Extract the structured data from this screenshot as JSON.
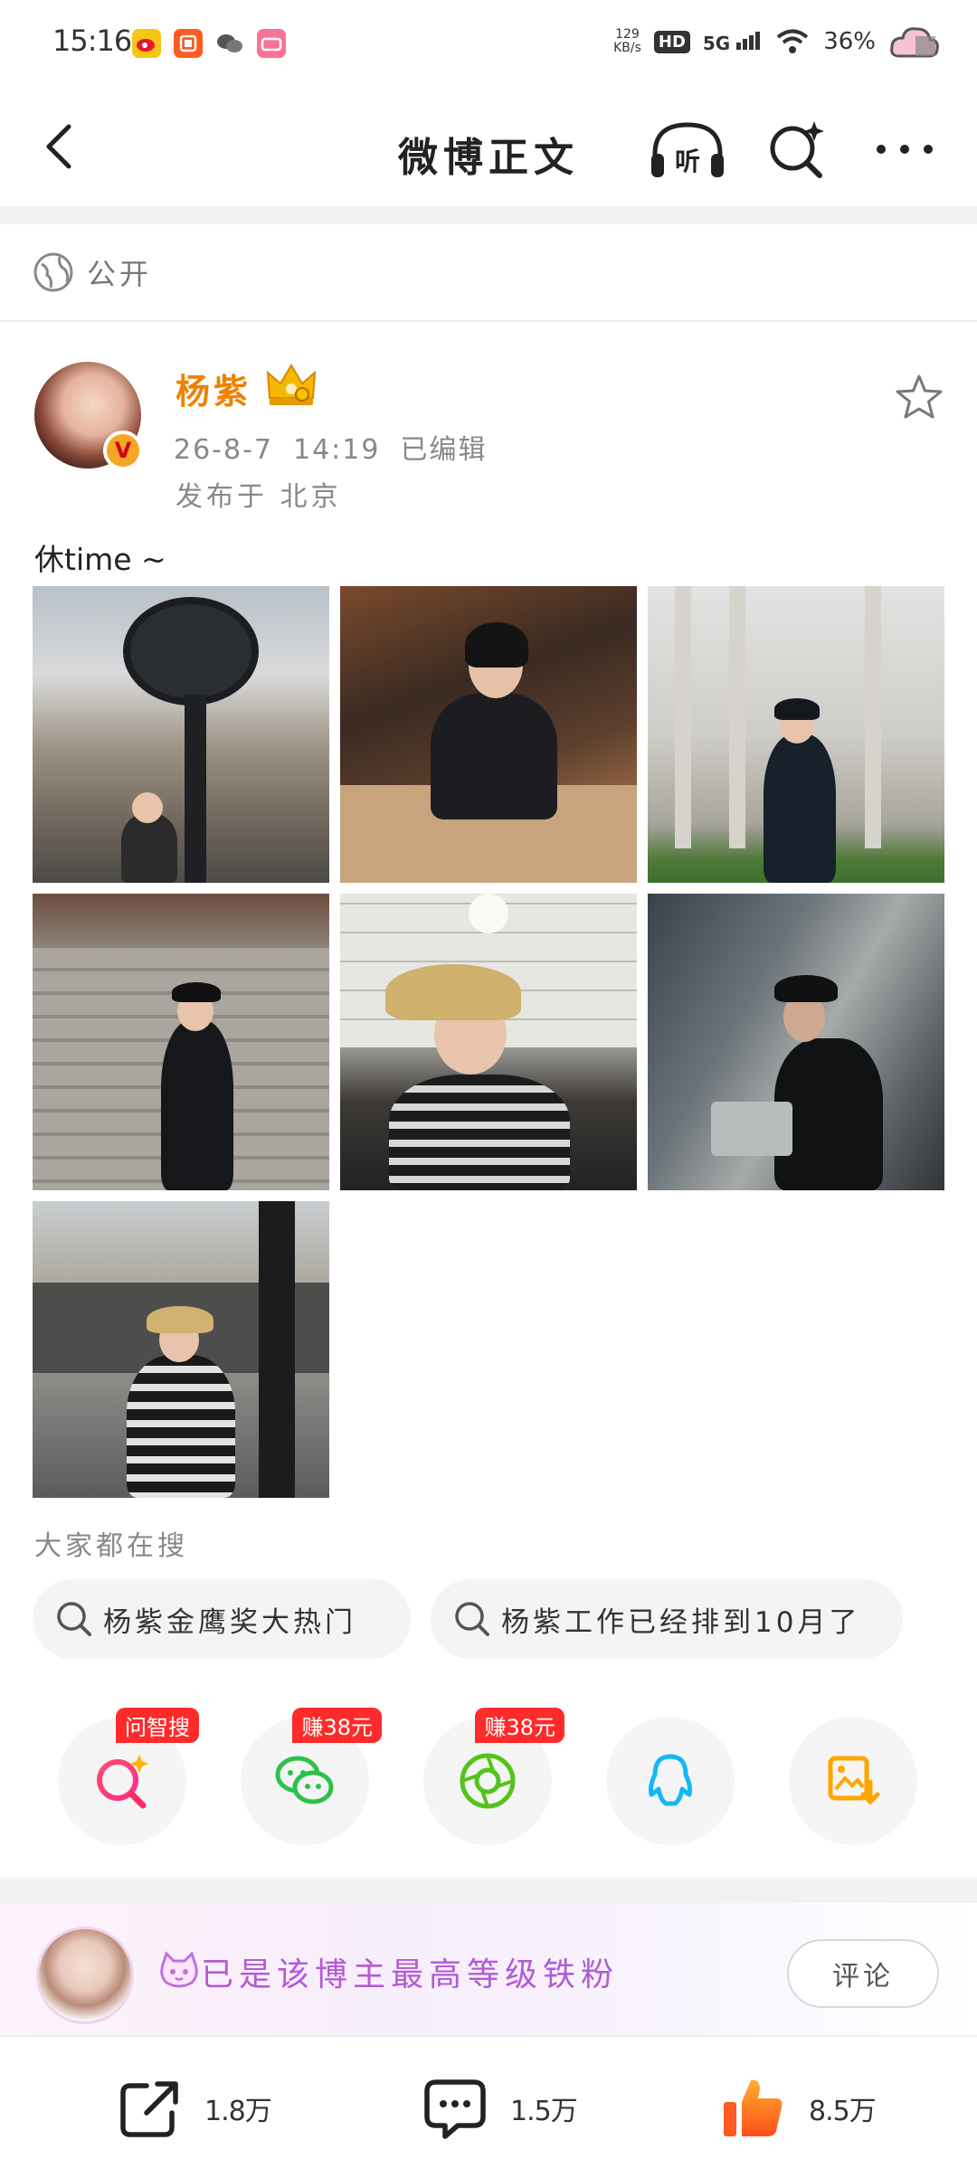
{
  "status_bar": {
    "time": "15:16",
    "net_speed_value": "129",
    "net_speed_unit": "KB/s",
    "hd": "HD",
    "network": "5G",
    "battery": "36%",
    "apps": [
      "weibo-app",
      "app-red",
      "wechat-app",
      "bilibili-app"
    ]
  },
  "nav": {
    "title": "微博正文",
    "listen_label": "听"
  },
  "visibility": {
    "label": "公开"
  },
  "author": {
    "name": "杨紫",
    "badge": "V",
    "date": "26-8-7",
    "time": "14:19",
    "edited": "已编辑",
    "location": "发布于 北京"
  },
  "post": {
    "text": "休time ~",
    "image_count": 7
  },
  "search": {
    "title": "大家都在搜",
    "chips": [
      "杨紫金鹰奖大热门",
      "杨紫工作已经排到10月了"
    ]
  },
  "share_row": {
    "items": [
      {
        "icon": "ai-search-icon",
        "badge": "问智搜"
      },
      {
        "icon": "wechat-icon",
        "badge": "赚38元"
      },
      {
        "icon": "moments-icon",
        "badge": "赚38元"
      },
      {
        "icon": "qq-icon",
        "badge": ""
      },
      {
        "icon": "save-image-icon",
        "badge": ""
      }
    ]
  },
  "fan": {
    "text": "已是该博主最高等级铁粉",
    "comment_label": "评论"
  },
  "bottom_bar": {
    "repost_count": "1.8万",
    "comment_count": "1.5万",
    "like_count": "8.5万"
  },
  "colors": {
    "author_name": "#f08100",
    "fan_text": "#b35ad6",
    "badge_red": "#ff2a2a",
    "like_orange": "#ff6a1a"
  }
}
